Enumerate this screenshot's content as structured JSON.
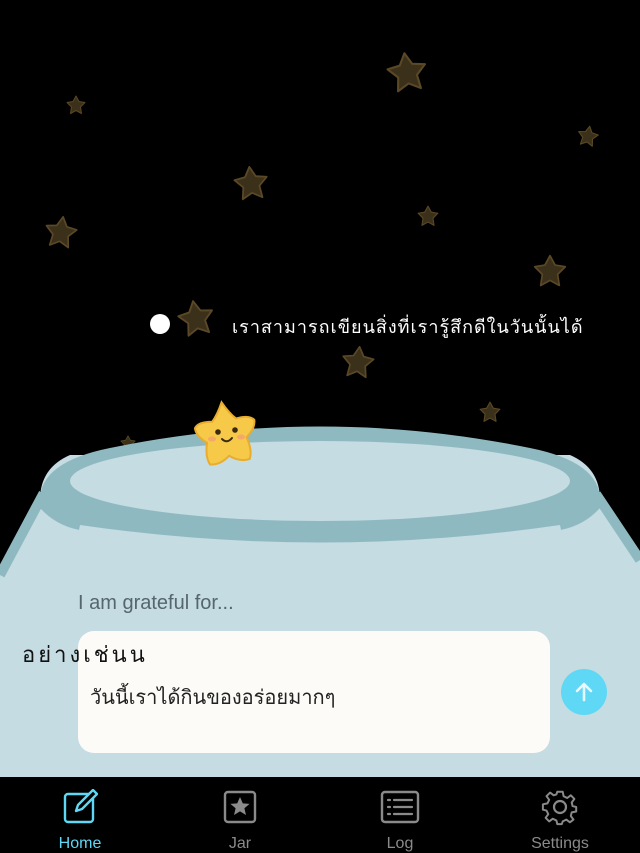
{
  "annotation": {
    "line_1": "เราสามารถเขียนสิ่งที่เรารู้สึกดีในวันนั้นได้",
    "line_2": "อย่างเช่นน"
  },
  "entry": {
    "prompt": "I am grateful for...",
    "value": "วันนี้เราได้กินของอร่อยมากๆ"
  },
  "tabs": [
    {
      "label": "Home",
      "icon": "compose-icon",
      "active": true
    },
    {
      "label": "Jar",
      "icon": "star-square-icon",
      "active": false
    },
    {
      "label": "Log",
      "icon": "list-icon",
      "active": false
    },
    {
      "label": "Settings",
      "icon": "gear-icon",
      "active": false
    }
  ],
  "colors": {
    "accent": "#5ed8f5",
    "jar": "#c4dce2",
    "jar_rim": "#8fb9c0",
    "star_dim": "#3a3018",
    "mascot": "#f7c948"
  }
}
